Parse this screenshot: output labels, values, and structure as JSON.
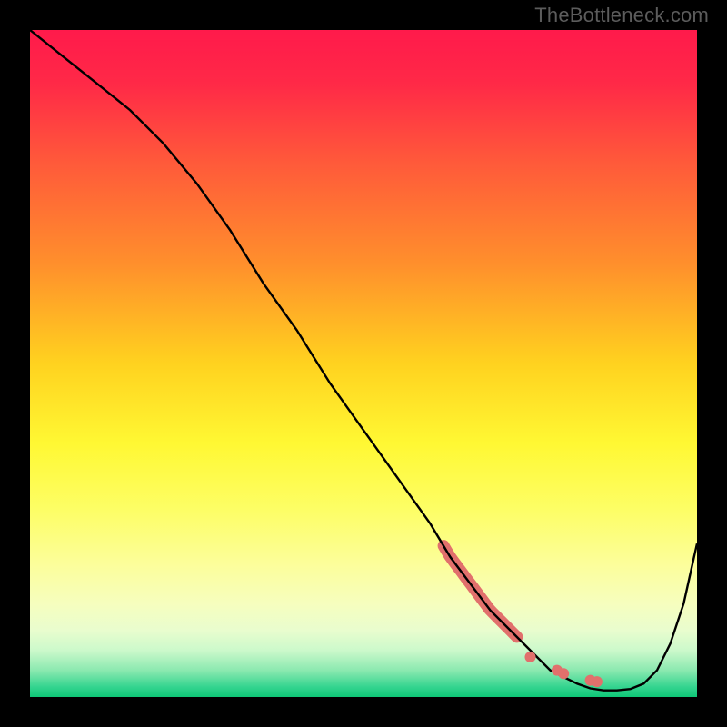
{
  "watermark": "TheBottleneck.com",
  "colors": {
    "background": "#000000",
    "watermark": "#5c5c5c",
    "curve_stroke": "#000000",
    "marker_fill": "#e1706c",
    "gradient_stops": [
      {
        "offset": 0.0,
        "color": "#ff1a4b"
      },
      {
        "offset": 0.08,
        "color": "#ff2947"
      },
      {
        "offset": 0.2,
        "color": "#ff5a3a"
      },
      {
        "offset": 0.35,
        "color": "#ff8f2c"
      },
      {
        "offset": 0.5,
        "color": "#ffd21f"
      },
      {
        "offset": 0.62,
        "color": "#fff833"
      },
      {
        "offset": 0.72,
        "color": "#fdfe66"
      },
      {
        "offset": 0.8,
        "color": "#fcfe9a"
      },
      {
        "offset": 0.86,
        "color": "#f6febe"
      },
      {
        "offset": 0.9,
        "color": "#e9fdce"
      },
      {
        "offset": 0.93,
        "color": "#ccf9cb"
      },
      {
        "offset": 0.96,
        "color": "#8be9b0"
      },
      {
        "offset": 0.985,
        "color": "#34d48f"
      },
      {
        "offset": 1.0,
        "color": "#0ec777"
      }
    ]
  },
  "chart_data": {
    "type": "line",
    "title": "",
    "xlabel": "",
    "ylabel": "",
    "xlim": [
      0,
      100
    ],
    "ylim": [
      0,
      100
    ],
    "grid": false,
    "legend": false,
    "series": [
      {
        "name": "bottleneck-curve",
        "x": [
          0,
          5,
          10,
          15,
          20,
          25,
          30,
          35,
          40,
          45,
          50,
          55,
          60,
          63,
          66,
          69,
          72,
          75,
          78,
          80,
          82,
          84,
          86,
          88,
          90,
          92,
          94,
          96,
          98,
          100
        ],
        "y": [
          100,
          96,
          92,
          88,
          83,
          77,
          70,
          62,
          55,
          47,
          40,
          33,
          26,
          21,
          17,
          13,
          10,
          7,
          4,
          3,
          2,
          1.3,
          1,
          1,
          1.2,
          2,
          4,
          8,
          14,
          23
        ]
      }
    ],
    "highlight_segment": {
      "comment": "thick salmon segment of the curve (approximate x-range where it appears)",
      "series": "bottleneck-curve",
      "x_start": 62,
      "x_end": 73
    },
    "markers": [
      {
        "x": 75,
        "y": 6
      },
      {
        "x": 79,
        "y": 4
      },
      {
        "x": 80,
        "y": 3.5
      },
      {
        "x": 84,
        "y": 2.5
      },
      {
        "x": 85,
        "y": 2.3
      }
    ]
  }
}
